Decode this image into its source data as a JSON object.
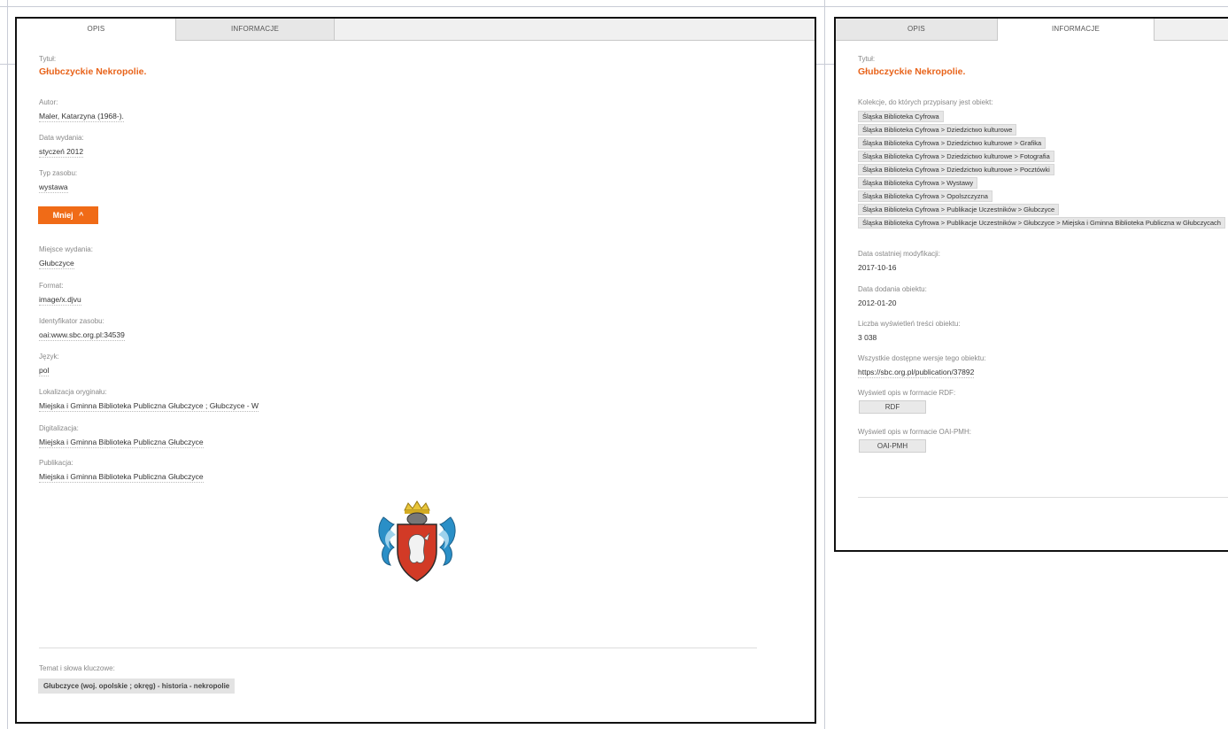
{
  "left": {
    "tabs": [
      {
        "label": "OPIS"
      },
      {
        "label": "INFORMACJE"
      }
    ],
    "fields": {
      "tytul_label": "Tytuł:",
      "tytul": "Głubczyckie Nekropolie.",
      "autor_label": "Autor:",
      "autor": "Maler, Katarzyna (1968-).",
      "data_label": "Data wydania:",
      "data": "styczeń 2012",
      "typ_label": "Typ zasobu:",
      "typ": "wystawa",
      "mniej": "Mniej",
      "miejsce_label": "Miejsce wydania:",
      "miejsce": "Głubczyce",
      "format_label": "Format:",
      "format": "image/x.djvu",
      "id_label": "Identyfikator zasobu:",
      "id": "oai:www.sbc.org.pl:34539",
      "jezyk_label": "Język:",
      "jezyk": "pol",
      "lok_label": "Lokalizacja oryginału:",
      "lok": "Miejska i Gminna Biblioteka Publiczna Głubczyce ; Głubczyce - W",
      "dig_label": "Digitalizacja:",
      "dig": "Miejska i Gminna Biblioteka Publiczna Głubczyce",
      "pub_label": "Publikacja:",
      "pub": "Miejska i Gminna Biblioteka Publiczna Głubczyce",
      "temat_label": "Temat i słowa kluczowe:",
      "temat": "Głubczyce (woj. opolskie ; okręg) - historia - nekropolie"
    }
  },
  "right": {
    "tabs": [
      {
        "label": "OPIS"
      },
      {
        "label": "INFORMACJE"
      }
    ],
    "fields": {
      "tytul_label": "Tytuł:",
      "tytul": "Głubczyckie Nekropolie.",
      "kolekcje_label": "Kolekcje, do których przypisany jest obiekt:",
      "modyf_label": "Data ostatniej modyfikacji:",
      "modyf": "2017-10-16",
      "dodania_label": "Data dodania obiektu:",
      "dodania": "2012-01-20",
      "liczba_label": "Liczba wyświetleń treści obiektu:",
      "liczba": "3 038",
      "wersje_label": "Wszystkie dostępne wersje tego obiektu:",
      "wersje": "https://sbc.org.pl/publication/37892",
      "rdf_label": "Wyświetl opis w formacie RDF:",
      "rdf": "RDF",
      "oai_label": "Wyświetl opis w formacie OAI-PMH:",
      "oai": "OAI-PMH"
    },
    "collections": [
      "Śląska Biblioteka Cyfrowa",
      "Śląska Biblioteka Cyfrowa > Dziedzictwo kulturowe",
      "Śląska Biblioteka Cyfrowa > Dziedzictwo kulturowe > Grafika",
      "Śląska Biblioteka Cyfrowa > Dziedzictwo kulturowe > Fotografia",
      "Śląska Biblioteka Cyfrowa > Dziedzictwo kulturowe > Pocztówki",
      "Śląska Biblioteka Cyfrowa > Wystawy",
      "Śląska Biblioteka Cyfrowa > Opolszczyzna",
      "Śląska Biblioteka Cyfrowa > Publikacje Uczestników > Głubczyce",
      "Śląska Biblioteka Cyfrowa > Publikacje Uczestników > Głubczyce > Miejska i Gminna Biblioteka Publiczna w Głubczycach"
    ]
  }
}
